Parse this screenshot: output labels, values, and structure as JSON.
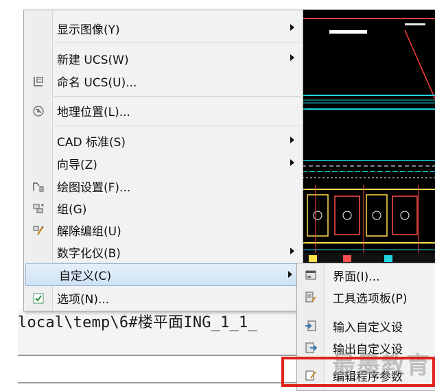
{
  "command_line": {
    "text": "local\\temp\\6#楼平面ING_1_1_"
  },
  "menu": {
    "items": [
      {
        "label": "显示图像(Y)",
        "submenu": true,
        "icon": "none"
      },
      {
        "label": "新建 UCS(W)",
        "submenu": true,
        "icon": "none"
      },
      {
        "label": "命名 UCS(U)...",
        "submenu": false,
        "icon": "ucs-named-icon"
      },
      {
        "label": "地理位置(L)...",
        "submenu": false,
        "icon": "geographic-location-icon"
      },
      {
        "label": "CAD 标准(S)",
        "submenu": true,
        "icon": "none"
      },
      {
        "label": "向导(Z)",
        "submenu": true,
        "icon": "none"
      },
      {
        "label": "绘图设置(F)...",
        "submenu": false,
        "icon": "drafting-settings-icon"
      },
      {
        "label": "组(G)",
        "submenu": false,
        "icon": "group-icon"
      },
      {
        "label": "解除编组(U)",
        "submenu": false,
        "icon": "ungroup-icon"
      },
      {
        "label": "数字化仪(B)",
        "submenu": true,
        "icon": "none"
      },
      {
        "label": "自定义(C)",
        "submenu": true,
        "icon": "none",
        "highlighted": true
      },
      {
        "label": "选项(N)...",
        "submenu": false,
        "icon": "options-checkbox-icon"
      }
    ]
  },
  "submenu": {
    "items": [
      {
        "label": "界面(I)...",
        "icon": "interface-icon"
      },
      {
        "label": "工具选项板(P)",
        "icon": "tool-palettes-icon"
      },
      {
        "label": "输入自定义设",
        "icon": "import-customizations-icon"
      },
      {
        "label": "输出自定义设",
        "icon": "export-customizations-icon"
      },
      {
        "label": "编辑程序参数",
        "icon": "edit-program-parameters-icon"
      }
    ]
  },
  "watermark": {
    "text": "最墨教育"
  },
  "colors": {
    "menu_bg": "#f2f2f2",
    "highlight": "#cfe2f7",
    "canvas_bg": "#000000",
    "annotation_red": "#e0221a"
  }
}
